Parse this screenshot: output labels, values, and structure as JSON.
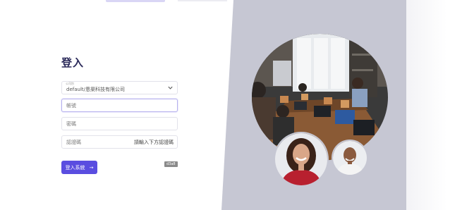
{
  "login": {
    "title": "登入",
    "company_label": "公司別",
    "company_value": "default/恩渠科技有限公司",
    "account_placeholder": "帳號",
    "password_placeholder": "密碼",
    "captcha_placeholder": "認證碼",
    "captcha_hint": "請輸入下方認證碼",
    "captcha_code": "d3a8",
    "submit_label": "登入系統",
    "submit_arrow": "→"
  },
  "colors": {
    "accent": "#5a4de0",
    "panel": "#c6c7d3",
    "title": "#2b2a5a"
  },
  "icons": {
    "company_dropdown": "chevron-down-icon",
    "submit": "arrow-right-icon"
  }
}
